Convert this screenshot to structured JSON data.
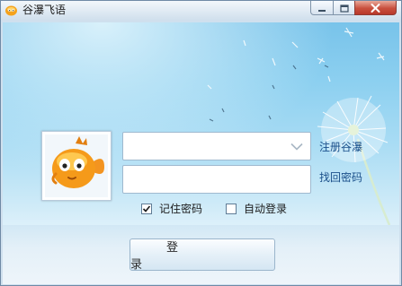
{
  "window": {
    "title": "谷瀑飞语",
    "icon": "app-logo-icon",
    "controls": [
      "minimize-icon",
      "maximize-icon",
      "close-icon"
    ]
  },
  "avatar": {
    "icon": "fish-avatar-icon"
  },
  "login": {
    "account_value": "",
    "password_value": "",
    "dropdown_icon": "chevron-down-icon",
    "register_link": "注册谷瀑",
    "find_password_link": "找回密码",
    "remember_password": {
      "label": "记住密码",
      "checked": true
    },
    "auto_login": {
      "label": "自动登录",
      "checked": false
    },
    "login_button": "登 录"
  },
  "colors": {
    "sky_top": "#78c3ea",
    "sky_bottom": "#dcf0fa",
    "link": "#1a4f8a",
    "close_button": "#c9503e",
    "avatar_fish": "#f59a1a"
  }
}
